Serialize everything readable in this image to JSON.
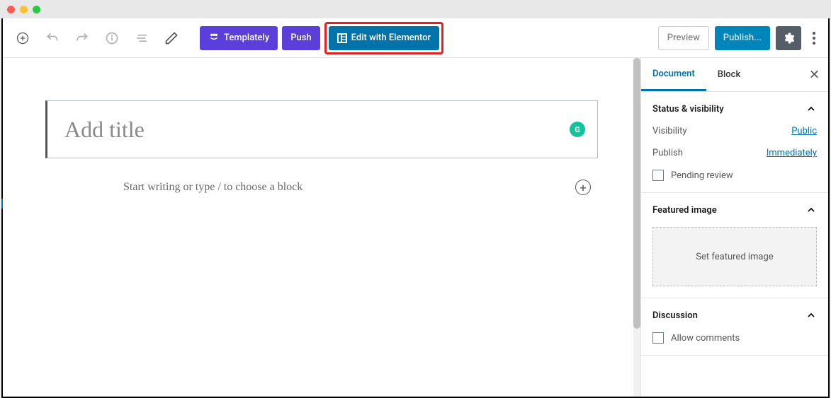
{
  "toolbar": {
    "templately_label": "Templately",
    "push_label": "Push",
    "elementor_label": "Edit with Elementor",
    "preview_label": "Preview",
    "publish_label": "Publish..."
  },
  "editor": {
    "title_placeholder": "Add title",
    "content_placeholder": "Start writing or type / to choose a block"
  },
  "sidebar": {
    "tabs": [
      "Document",
      "Block"
    ],
    "status_panel": {
      "title": "Status & visibility",
      "visibility_label": "Visibility",
      "visibility_value": "Public",
      "publish_label": "Publish",
      "publish_value": "Immediately",
      "pending_label": "Pending review"
    },
    "featured_panel": {
      "title": "Featured image",
      "placeholder": "Set featured image"
    },
    "discussion_panel": {
      "title": "Discussion",
      "allow_comments": "Allow comments"
    }
  }
}
